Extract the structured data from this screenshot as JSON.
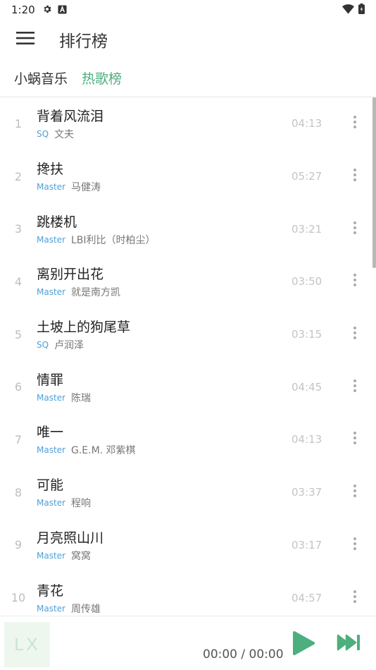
{
  "status_bar": {
    "time": "1:20",
    "icons": [
      "gear-icon",
      "a-box-icon",
      "wifi-icon",
      "battery-icon"
    ]
  },
  "header": {
    "title": "排行榜",
    "menu_icon": "hamburger-menu-icon"
  },
  "tabs": {
    "source": "小蜗音乐",
    "active": "热歌榜"
  },
  "colors": {
    "accent": "#4caf7d",
    "quality": "#4ea0d8"
  },
  "songs": [
    {
      "rank": "1",
      "title": "背着风流泪",
      "quality": "SQ",
      "artist": "文夫",
      "duration": "04:13"
    },
    {
      "rank": "2",
      "title": "搀扶",
      "quality": "Master",
      "artist": "马健涛",
      "duration": "05:27"
    },
    {
      "rank": "3",
      "title": "跳楼机",
      "quality": "Master",
      "artist": "LBI利比（时柏尘）",
      "duration": "03:21"
    },
    {
      "rank": "4",
      "title": "离别开出花",
      "quality": "Master",
      "artist": "就是南方凯",
      "duration": "03:50"
    },
    {
      "rank": "5",
      "title": "土坡上的狗尾草",
      "quality": "SQ",
      "artist": "卢润泽",
      "duration": "03:15"
    },
    {
      "rank": "6",
      "title": "情罪",
      "quality": "Master",
      "artist": "陈瑞",
      "duration": "04:45"
    },
    {
      "rank": "7",
      "title": "唯一",
      "quality": "Master",
      "artist": "G.E.M. 邓紫棋",
      "duration": "04:13"
    },
    {
      "rank": "8",
      "title": "可能",
      "quality": "Master",
      "artist": "程响",
      "duration": "03:37"
    },
    {
      "rank": "9",
      "title": "月亮照山川",
      "quality": "Master",
      "artist": "窝窝",
      "duration": "03:17"
    },
    {
      "rank": "10",
      "title": "青花",
      "quality": "Master",
      "artist": "周传雄",
      "duration": "04:57"
    }
  ],
  "player": {
    "cover_text": "LX",
    "time": "00:00 / 00:00",
    "play_icon": "play-icon",
    "next_icon": "skip-next-icon"
  }
}
